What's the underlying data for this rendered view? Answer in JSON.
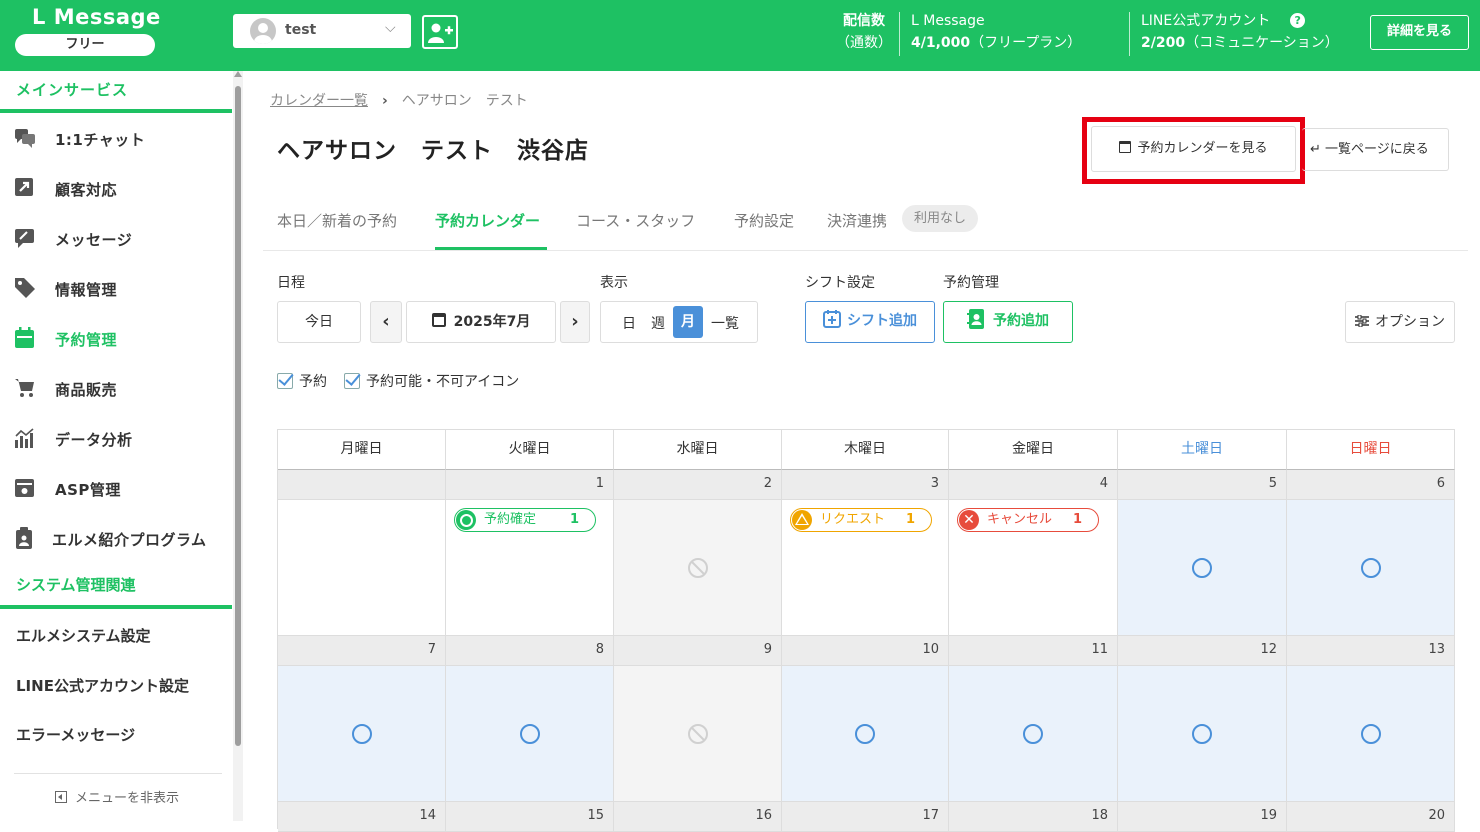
{
  "header": {
    "logo": "L Message",
    "plan": "フリー",
    "account": "test",
    "delivery_label_1": "配信数",
    "delivery_label_2": "（通数）",
    "lmessage_label": "L Message",
    "lmessage_count": "4/1,000",
    "lmessage_plan": "（フリープラン）",
    "line_label": "LINE公式アカウント",
    "line_count": "2/200",
    "line_plan": "（コミュニケーション）",
    "help": "?",
    "detail_button": "詳細を見る"
  },
  "sidebar": {
    "main_section": "メインサービス",
    "items": [
      {
        "label": "1:1チャット",
        "icon": "chat-icon"
      },
      {
        "label": "顧客対応",
        "icon": "arrow-out-icon"
      },
      {
        "label": "メッセージ",
        "icon": "message-icon"
      },
      {
        "label": "情報管理",
        "icon": "tag-icon"
      },
      {
        "label": "予約管理",
        "icon": "calendar-icon"
      },
      {
        "label": "商品販売",
        "icon": "cart-icon"
      },
      {
        "label": "データ分析",
        "icon": "analytics-icon"
      },
      {
        "label": "ASP管理",
        "icon": "asp-icon"
      },
      {
        "label": "エルメ紹介プログラム",
        "icon": "clipboard-person-icon"
      }
    ],
    "system_section": "システム管理関連",
    "system_items": [
      "エルメシステム設定",
      "LINE公式アカウント設定",
      "エラーメッセージ"
    ],
    "hide_menu": "メニューを非表示"
  },
  "main": {
    "breadcrumb_link": "カレンダー一覧",
    "breadcrumb_current": "ヘアサロン　テスト",
    "title": "ヘアサロン　テスト　渋谷店",
    "view_calendar_button": "予約カレンダーを見る",
    "back_button": "一覧ページに戻る",
    "tabs": [
      "本日／新着の予約",
      "予約カレンダー",
      "コース・スタッフ",
      "予約設定",
      "決済連携"
    ],
    "tab_badge": "利用なし",
    "controls": {
      "schedule_label": "日程",
      "today": "今日",
      "prev": "‹",
      "month": "2025年7月",
      "next": "›",
      "display_label": "表示",
      "views": [
        "日",
        "週",
        "月",
        "一覧"
      ],
      "shift_label": "シフト設定",
      "shift_button": "シフト追加",
      "reservation_label": "予約管理",
      "reservation_button": "予約追加",
      "options_button": "オプション"
    },
    "filters": [
      "予約",
      "予約可能・不可アイコン"
    ]
  },
  "calendar": {
    "weekdays": [
      "月曜日",
      "火曜日",
      "水曜日",
      "木曜日",
      "金曜日",
      "土曜日",
      "日曜日"
    ],
    "week1_days": [
      "",
      "1",
      "2",
      "3",
      "4",
      "5",
      "6"
    ],
    "week2_days": [
      "7",
      "8",
      "9",
      "10",
      "11",
      "12",
      "13"
    ],
    "week3_days": [
      "14",
      "15",
      "16",
      "17",
      "18",
      "19",
      "20"
    ],
    "pills": {
      "confirmed": {
        "label": "予約確定",
        "count": "1"
      },
      "request": {
        "label": "リクエスト",
        "count": "1"
      },
      "cancel": {
        "label": "キャンセル",
        "count": "1",
        "icon": "✕"
      }
    }
  },
  "colors": {
    "brand_green": "#1ec163",
    "accent_blue": "#4a90d9",
    "highlight_red": "#e60012"
  }
}
